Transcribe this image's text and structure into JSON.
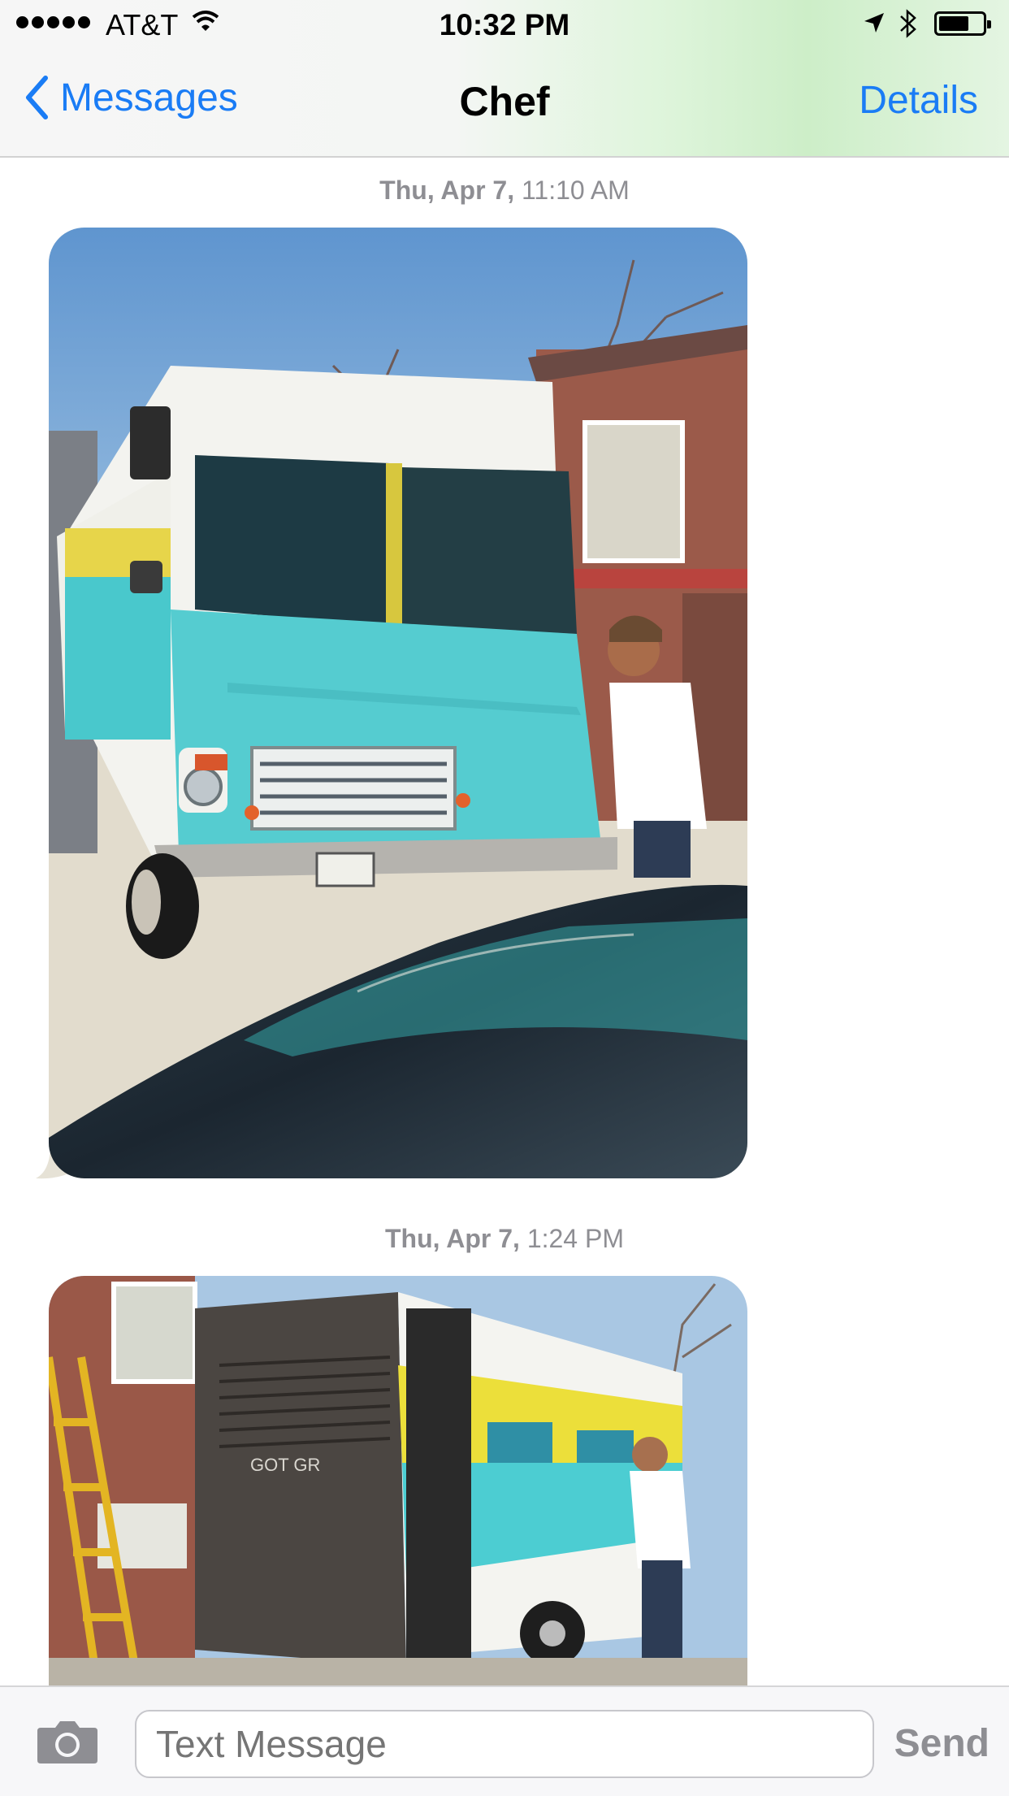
{
  "status_bar": {
    "carrier": "AT&T",
    "time": "10:32 PM",
    "signal_icon": "signal-dots-icon",
    "wifi_icon": "wifi-icon",
    "location_icon": "location-arrow-icon",
    "bluetooth_icon": "bluetooth-icon",
    "battery_icon": "battery-icon",
    "battery_level": 0.7
  },
  "nav": {
    "back_label": "Messages",
    "title": "Chef",
    "details_label": "Details"
  },
  "messages": [
    {
      "date": "Thu, Apr 7,",
      "time": "11:10 AM",
      "attachment": "photo of turquoise food truck being painted"
    },
    {
      "date": "Thu, Apr 7,",
      "time": "1:24 PM",
      "attachment": "photo of back of food truck with yellow stripe"
    }
  ],
  "composer": {
    "placeholder": "Text Message",
    "send_label": "Send",
    "camera_icon": "camera-icon"
  },
  "colors": {
    "accent": "#1a7cf5",
    "timestamp": "#8e8e93"
  }
}
